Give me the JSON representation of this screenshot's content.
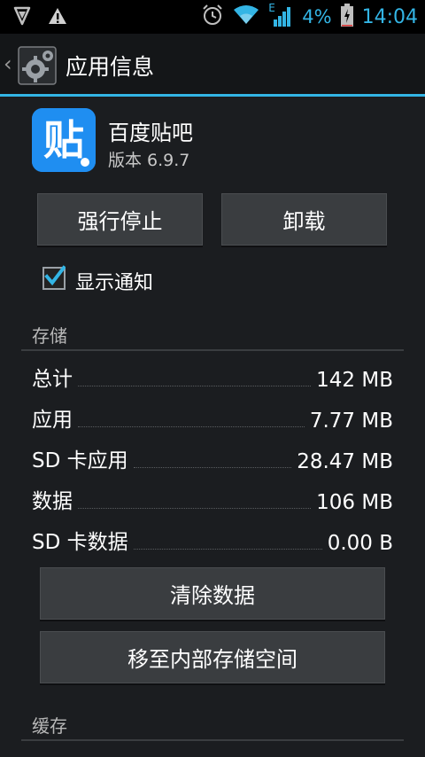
{
  "status_bar": {
    "battery_percent": "4%",
    "time": "14:04",
    "network_type": "E",
    "icons": [
      "shield-icon",
      "warning-icon",
      "alarm-icon",
      "wifi-icon",
      "signal-icon",
      "battery-charging-icon"
    ]
  },
  "action_bar": {
    "title": "应用信息"
  },
  "app": {
    "name": "百度贴吧",
    "version": "版本 6.9.7",
    "icon_glyph": "贴",
    "icon_color": "#1f8ef1"
  },
  "buttons": {
    "force_stop": "强行停止",
    "uninstall": "卸载",
    "clear_data": "清除数据",
    "move_storage": "移至内部存储空间"
  },
  "notification": {
    "label": "显示通知",
    "checked": true
  },
  "storage": {
    "title": "存储",
    "rows": [
      {
        "label": "总计",
        "value": "142 MB"
      },
      {
        "label": "应用",
        "value": "7.77 MB"
      },
      {
        "label": "SD 卡应用",
        "value": "28.47 MB"
      },
      {
        "label": "数据",
        "value": "106 MB"
      },
      {
        "label": "SD 卡数据",
        "value": "0.00 B"
      }
    ]
  },
  "cache": {
    "title": "缓存"
  },
  "colors": {
    "accent": "#33b5e5",
    "background": "#1b1d20"
  }
}
